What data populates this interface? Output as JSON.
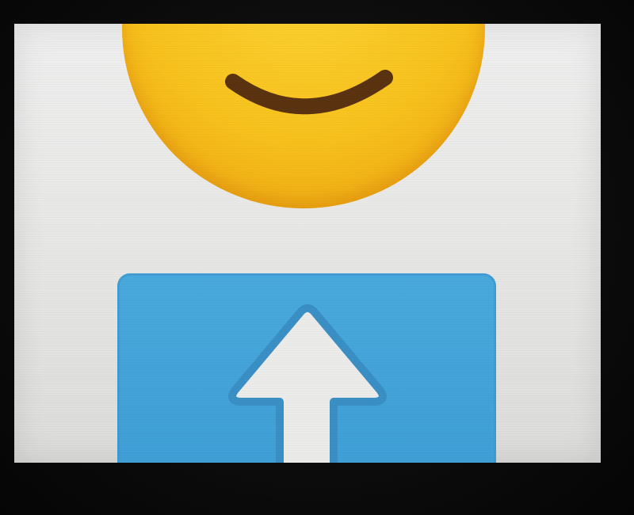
{
  "screen": {
    "background_color": "#e9e9e7"
  },
  "emoji": {
    "icon": "smiling-face-icon",
    "face_color": "#f8c21d",
    "mouth_color": "#5a3310"
  },
  "upload_button": {
    "icon": "up-arrow-icon",
    "tile_color": "#42a3d8",
    "arrow_color": "#ebebe9"
  }
}
